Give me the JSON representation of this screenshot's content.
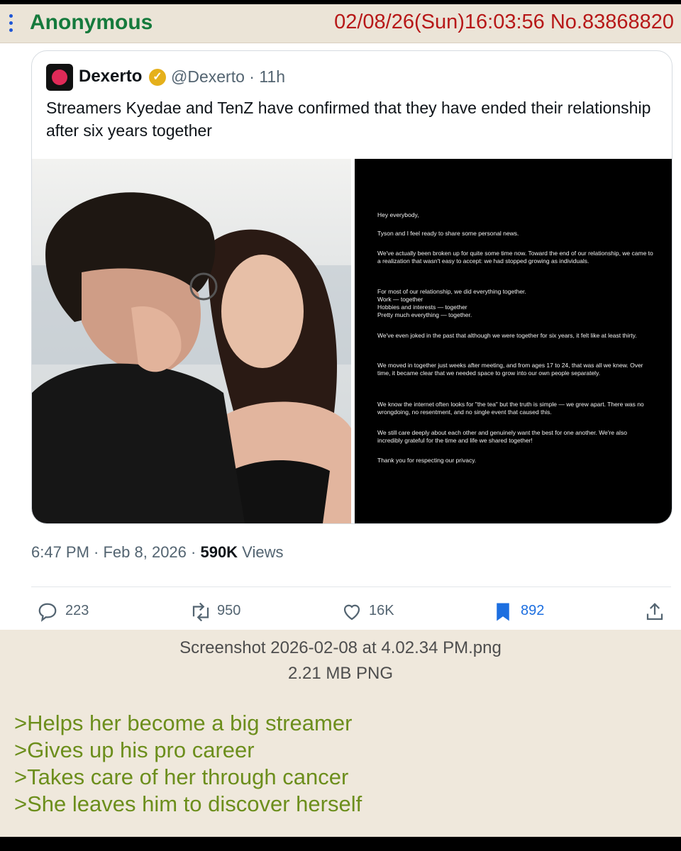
{
  "post": {
    "name": "Anonymous",
    "meta": "02/08/26(Sun)16:03:56 No.83868820",
    "file_name": "Screenshot 2026-02-08 at 4.02.34 PM.png",
    "file_size": "2.21 MB PNG",
    "greentext": [
      ">Helps her become a big streamer",
      ">Gives up his pro career",
      ">Takes care of her through cancer",
      ">She leaves him to discover herself"
    ],
    "colors": {
      "name": "#157a3c",
      "meta": "#b71818",
      "greentext": "#6c8e1c",
      "post_bg": "#efe8dc"
    }
  },
  "tweet": {
    "author": "Dexerto",
    "handle_time": "@Dexerto · 11h",
    "text": "Streamers Kyedae and TenZ have confirmed that they have ended their relationship after six years together",
    "timestamp": "6:47 PM · Feb 8, 2026 · ",
    "views_count": "590K",
    "views_label": " Views",
    "actions": {
      "replies": "223",
      "reposts": "950",
      "likes": "16K",
      "bookmarks": "892"
    },
    "icons": [
      "reply-icon",
      "repost-icon",
      "like-icon",
      "bookmark-icon",
      "share-icon",
      "verified-icon"
    ],
    "statement": [
      "Hey everybody,",
      "Tyson and I feel ready to share some personal news.",
      "We've actually been broken up for quite some time now. Toward the end of our relationship, we came to a realization that wasn't easy to accept: we had stopped growing as individuals.",
      "For most of our relationship, we did everything together.",
      "Work — together",
      "Hobbies and interests — together",
      "Pretty much everything — together.",
      "We've even joked in the past that although we were together for six years, it felt like at least thirty.",
      "We moved in together just weeks after meeting, and from ages 17 to 24, that was all we knew. Over time, it became clear that we needed space to grow into our own people separately.",
      "We know the internet often looks for \"the tea\" but the truth is simple — we grew apart. There was no wrongdoing, no resentment, and no single event that caused this.",
      "We still care deeply about each other and genuinely want the best for one another. We're also incredibly grateful for the time and life we shared together!",
      "Thank you for respecting our privacy."
    ]
  }
}
